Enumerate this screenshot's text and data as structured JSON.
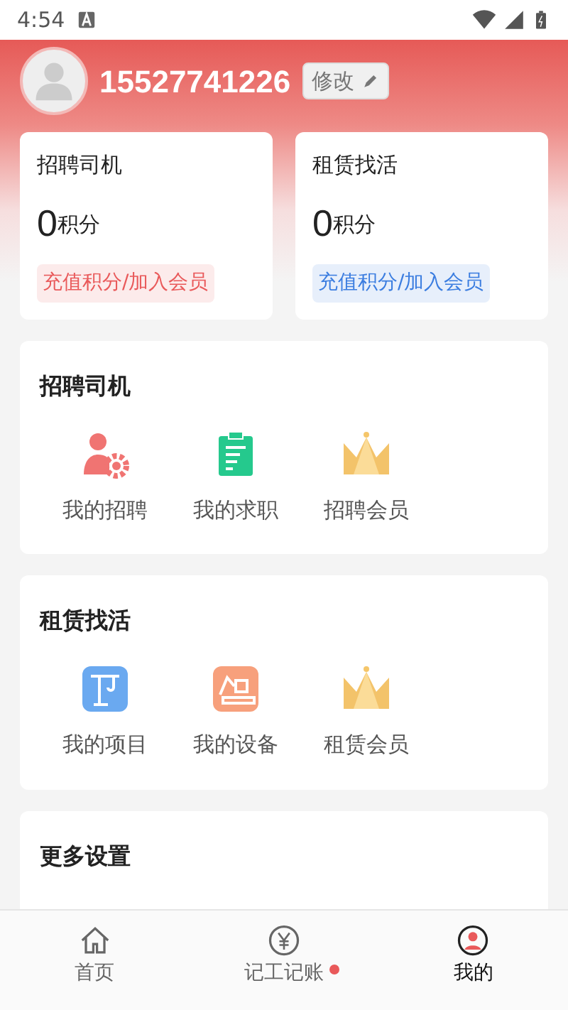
{
  "status_bar": {
    "time": "4:54"
  },
  "profile": {
    "phone": "15527741226",
    "edit_button": "修改"
  },
  "point_cards": [
    {
      "title": "招聘司机",
      "points": "0",
      "unit": "积分",
      "action": "充值积分/加入会员",
      "color": "#e9595a"
    },
    {
      "title": "租赁找活",
      "points": "0",
      "unit": "积分",
      "action": "充值积分/加入会员",
      "color": "#3b7de0"
    }
  ],
  "sections": [
    {
      "title": "招聘司机",
      "items": [
        {
          "label": "我的招聘",
          "kind": "person-gear"
        },
        {
          "label": "我的求职",
          "kind": "clipboard"
        },
        {
          "label": "招聘会员",
          "kind": "crown"
        }
      ]
    },
    {
      "title": "租赁找活",
      "items": [
        {
          "label": "我的项目",
          "kind": "crane"
        },
        {
          "label": "我的设备",
          "kind": "excavator"
        },
        {
          "label": "租赁会员",
          "kind": "crown"
        }
      ]
    },
    {
      "title": "更多设置"
    }
  ],
  "tab_bar": [
    {
      "label": "首页",
      "selected": false,
      "badge": false,
      "kind": "home"
    },
    {
      "label": "记工记账",
      "selected": false,
      "badge": true,
      "kind": "yen"
    },
    {
      "label": "我的",
      "selected": true,
      "badge": false,
      "kind": "user"
    }
  ]
}
